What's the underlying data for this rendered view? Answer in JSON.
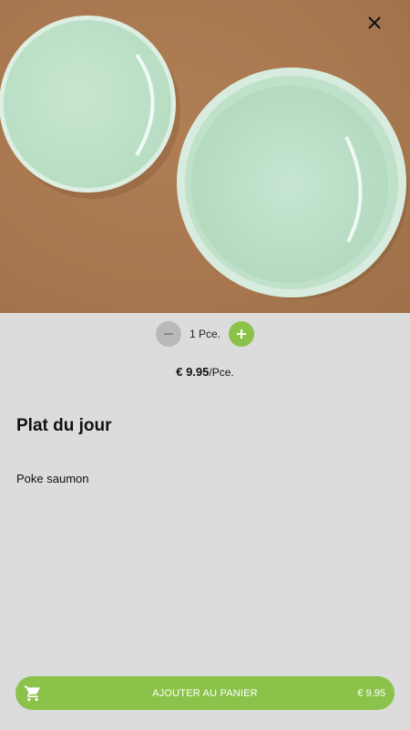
{
  "product": {
    "title": "Plat du jour",
    "description": "Poke saumon"
  },
  "quantity": {
    "value_label": "1 Pce."
  },
  "price": {
    "amount": "€ 9.95",
    "unit": "/Pce."
  },
  "cart": {
    "button_label": "AJOUTER AU PANIER",
    "total": "€ 9.95"
  },
  "colors": {
    "accent": "#8bc34a",
    "background": "#dcdcdc",
    "minus_button": "#b9b9b9"
  },
  "icons": {
    "close": "close-icon",
    "minus": "minus-icon",
    "plus": "plus-icon",
    "cart": "cart-icon"
  }
}
